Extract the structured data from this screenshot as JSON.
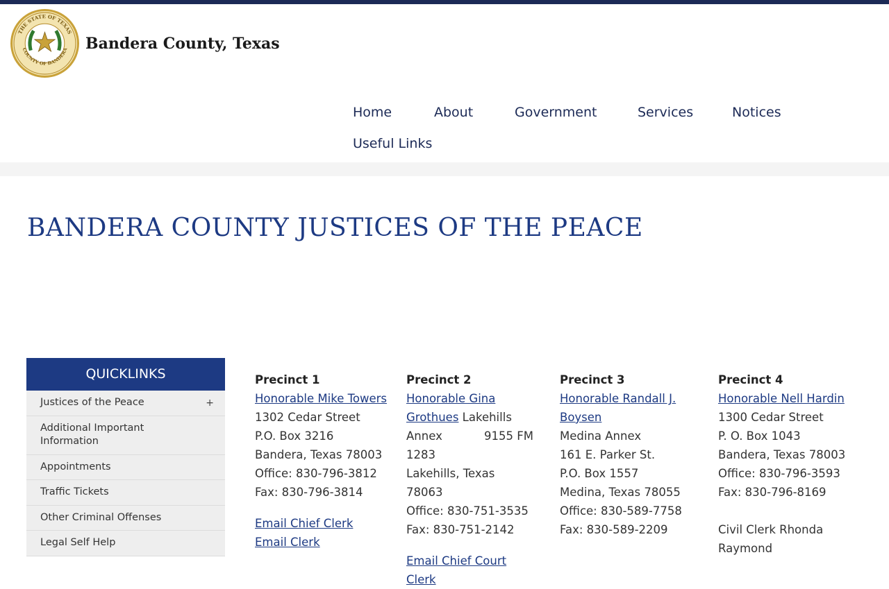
{
  "site": {
    "title": "Bandera County, Texas",
    "seal_text_top": "THE STATE OF TEXAS",
    "seal_text_bottom": "COUNTY OF BANDERA"
  },
  "nav": {
    "items": [
      {
        "label": "Home"
      },
      {
        "label": "About"
      },
      {
        "label": "Government"
      },
      {
        "label": "Services"
      },
      {
        "label": "Notices"
      },
      {
        "label": "Useful Links"
      }
    ]
  },
  "page": {
    "title": "BANDERA COUNTY JUSTICES OF THE PEACE"
  },
  "quicklinks": {
    "heading": "QUICKLINKS",
    "expand_symbol": "+",
    "items": [
      {
        "label": "Justices of the Peace"
      },
      {
        "label": "Additional Important Information"
      },
      {
        "label": "Appointments"
      },
      {
        "label": "Traffic Tickets"
      },
      {
        "label": "Other Criminal Offenses"
      },
      {
        "label": "Legal Self Help"
      }
    ]
  },
  "precincts": [
    {
      "heading": "Precinct 1",
      "judge": "Honorable Mike Towers",
      "lines": [
        "1302 Cedar Street",
        "P.O. Box 3216",
        "Bandera, Texas 78003",
        "Office: 830-796-3812",
        "Fax: 830-796-3814"
      ],
      "links": [
        "Email Chief Clerk",
        "Email Clerk"
      ]
    },
    {
      "heading": "Precinct 2",
      "judge": "Honorable Gina Grothues",
      "judge_line1": "Honorable Gina",
      "judge_line2": "Grothues",
      "after_judge": " Lakehills",
      "annex_word": "Annex",
      "annex_code": "9155 FM",
      "lines": [
        "1283",
        "Lakehills, Texas 78063",
        "Office: 830-751-3535",
        "Fax: 830-751-2142"
      ],
      "links": [
        "Email Chief Court Clerk"
      ]
    },
    {
      "heading": "Precinct 3",
      "judge_line1": "Honorable Randall J.",
      "judge_line2": "Boysen",
      "lines": [
        "Medina Annex",
        "161 E. Parker St.",
        "P.O. Box 1557",
        "Medina, Texas 78055",
        "Office: 830-589-7758",
        "Fax: 830-589-2209"
      ]
    },
    {
      "heading": "Precinct 4",
      "judge": "Honorable Nell Hardin",
      "lines": [
        "1300 Cedar Street",
        "P. O. Box 1043",
        "Bandera, Texas 78003",
        "Office: 830-796-3593",
        "Fax: 830-796-8169"
      ],
      "extra": [
        "Civil Clerk Rhonda",
        "Raymond"
      ]
    }
  ],
  "colors": {
    "navy": "#1c2a56",
    "accent_blue": "#1d3a83",
    "sidebar_bg": "#eeeeee",
    "seal_gold": "#c9a23a"
  }
}
